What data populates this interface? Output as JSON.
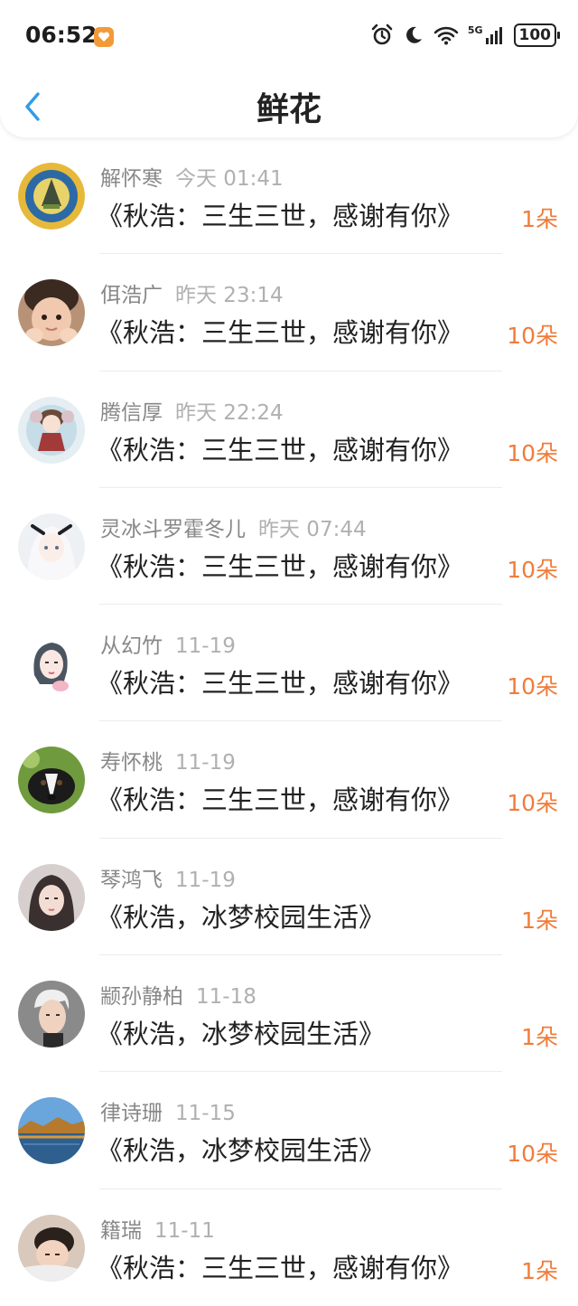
{
  "status_bar": {
    "time": "06:52",
    "signal_label": "5G",
    "battery": "100"
  },
  "header": {
    "title": "鲜花"
  },
  "colors": {
    "accent_orange": "#f07c3b",
    "back_blue": "#2f9be8"
  },
  "rows": [
    {
      "name": "解怀寒",
      "time": "今天 01:41",
      "book": "《秋浩：三生三世，感谢有你》",
      "count": "1朵",
      "avatar": "emblem-avatar"
    },
    {
      "name": "佴浩广",
      "time": "昨天 23:14",
      "book": "《秋浩：三生三世，感谢有你》",
      "count": "10朵",
      "avatar": "child-avatar"
    },
    {
      "name": "腾信厚",
      "time": "昨天 22:24",
      "book": "《秋浩：三生三世，感谢有你》",
      "count": "10朵",
      "avatar": "anime-figure-avatar"
    },
    {
      "name": "灵冰斗罗霍冬儿",
      "time": "昨天 07:44",
      "book": "《秋浩：三生三世，感谢有你》",
      "count": "10朵",
      "avatar": "anime-girl-avatar"
    },
    {
      "name": "从幻竹",
      "time": "11-19",
      "book": "《秋浩：三生三世，感谢有你》",
      "count": "10朵",
      "avatar": "illustration-avatar"
    },
    {
      "name": "寿怀桃",
      "time": "11-19",
      "book": "《秋浩：三生三世，感谢有你》",
      "count": "10朵",
      "avatar": "dog-avatar"
    },
    {
      "name": "琴鸿飞",
      "time": "11-19",
      "book": "《秋浩，冰梦校园生活》",
      "count": "1朵",
      "avatar": "portrait-avatar"
    },
    {
      "name": "颛孙静柏",
      "time": "11-18",
      "book": "《秋浩，冰梦校园生活》",
      "count": "1朵",
      "avatar": "man-avatar"
    },
    {
      "name": "律诗珊",
      "time": "11-15",
      "book": "《秋浩，冰梦校园生活》",
      "count": "10朵",
      "avatar": "landscape-avatar"
    },
    {
      "name": "籍瑞",
      "time": "11-11",
      "book": "《秋浩：三生三世，感谢有你》",
      "count": "1朵",
      "avatar": "sleeping-child-avatar"
    }
  ]
}
